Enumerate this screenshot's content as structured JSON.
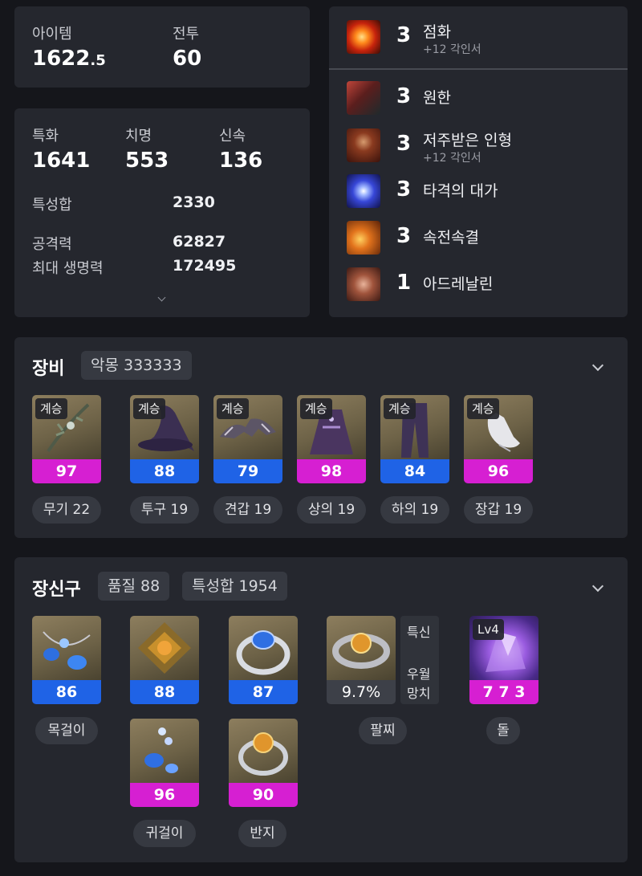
{
  "summary": {
    "item_label": "아이템",
    "item_value": "1622",
    "item_decimal": ".5",
    "combat_label": "전투",
    "combat_value": "60"
  },
  "stats": {
    "top": [
      {
        "label": "특화",
        "value": "1641"
      },
      {
        "label": "치명",
        "value": "553"
      },
      {
        "label": "신속",
        "value": "136"
      }
    ],
    "rows": [
      {
        "label": "특성합",
        "value": "2330"
      },
      {
        "label": "공격력",
        "value": "62827"
      },
      {
        "label": "최대 생명력",
        "value": "172495"
      }
    ]
  },
  "engravings": [
    {
      "level": "3",
      "name": "점화",
      "sub": "+12 각인서",
      "icon": "fire-burst-icon"
    },
    {
      "level": "3",
      "name": "원한",
      "sub": "",
      "icon": "demon-icon"
    },
    {
      "level": "3",
      "name": "저주받은 인형",
      "sub": "+12 각인서",
      "icon": "cursed-doll-icon"
    },
    {
      "level": "3",
      "name": "타격의 대가",
      "sub": "",
      "icon": "lightning-strike-icon"
    },
    {
      "level": "3",
      "name": "속전속결",
      "sub": "",
      "icon": "swift-warrior-icon"
    },
    {
      "level": "1",
      "name": "아드레날린",
      "sub": "",
      "icon": "adrenaline-icon"
    }
  ],
  "equipment": {
    "title": "장비",
    "badge": "악몽 333333",
    "items": [
      {
        "tag": "계승",
        "quality": "97",
        "color": "#d61fd2",
        "label": "무기 22",
        "icon": "weapon-branch-icon"
      },
      {
        "tag": "계승",
        "quality": "88",
        "color": "#1f63e6",
        "label": "투구 19",
        "icon": "witch-hat-icon"
      },
      {
        "tag": "계승",
        "quality": "79",
        "color": "#1f63e6",
        "label": "견갑 19",
        "icon": "shoulder-armor-icon"
      },
      {
        "tag": "계승",
        "quality": "98",
        "color": "#d61fd2",
        "label": "상의 19",
        "icon": "chest-dress-icon"
      },
      {
        "tag": "계승",
        "quality": "84",
        "color": "#1f63e6",
        "label": "하의 19",
        "icon": "leggings-icon"
      },
      {
        "tag": "계승",
        "quality": "96",
        "color": "#d61fd2",
        "label": "장갑 19",
        "icon": "glove-icon"
      }
    ]
  },
  "accessories": {
    "title": "장신구",
    "badge1": "품질 88",
    "badge2": "특성합 1954",
    "necklace": {
      "quality": "86",
      "label": "목걸이",
      "icon": "necklace-icon"
    },
    "earrings": [
      {
        "quality": "88",
        "icon": "earring-gold-icon"
      },
      {
        "quality": "96",
        "icon": "earring-blue-icon"
      }
    ],
    "earring_label": "귀걸이",
    "rings": [
      {
        "quality": "87",
        "icon": "ring-blue-icon"
      },
      {
        "quality": "90",
        "icon": "ring-gold-icon"
      }
    ],
    "ring_label": "반지",
    "bracelet": {
      "value": "9.7%",
      "side_top": "특신",
      "side_mid": "우월",
      "side_bot": "망치",
      "label": "팔찌",
      "icon": "bracelet-icon"
    },
    "stone": {
      "tag": "Lv4",
      "value": "7 7 3",
      "label": "돌",
      "icon": "ability-stone-icon"
    }
  }
}
